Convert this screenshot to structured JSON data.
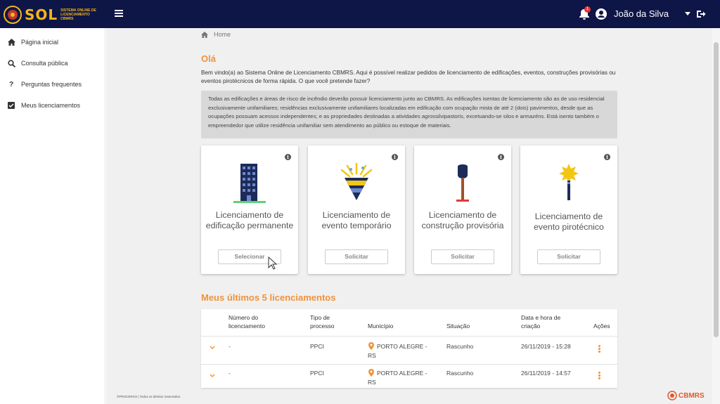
{
  "header": {
    "logo_text": "SOL",
    "logo_subtitle": "Sistema Online de Licenciamento CBMRS",
    "notification_count": "1",
    "user_name": "João da Silva",
    "brand_color": "#0e1647",
    "accent_color": "#f0923a"
  },
  "sidebar": {
    "items": [
      {
        "label": "Página inicial",
        "icon": "home-icon"
      },
      {
        "label": "Consulta pública",
        "icon": "search-icon"
      },
      {
        "label": "Perguntas frequentes",
        "icon": "question-icon"
      },
      {
        "label": "Meus licenciamentos",
        "icon": "checkbox-icon"
      }
    ]
  },
  "breadcrumb": {
    "home": "Home"
  },
  "main": {
    "greeting": "Olá",
    "intro": "Bem vindo(a) ao Sistema Online de Licenciamento CBMRS. Aqui é possível realizar pedidos de licenciamento de edificações, eventos, construções provisórias ou eventos pirotécnicos de forma rápida. O que você pretende fazer?",
    "notice": "Todas as edificações e áreas de risco de incêndio deverão possuir licenciamento junto ao CBMRS. As edificações isentas de licenciamento são as de uso residencial exclusivamente unifamiliares; residências exclusivamente unifamiliares localizadas em edificação com ocupação mista de até 2 (dois) pavimentos, desde que as ocupações possuam acessos independentes; e as propriedades destinadas a atividades agrossilvipastoris, excetuando-se silos e armazéns. Está isento também o empreendedor que utilize residência unifamiliar sem atendimento ao público ou estoque de materiais."
  },
  "cards": [
    {
      "title": "Licenciamento de edificação permanente",
      "button": "Selecionar",
      "icon": "building-icon"
    },
    {
      "title": "Licenciamento de evento temporário",
      "button": "Solicitar",
      "icon": "event-icon"
    },
    {
      "title": "Licenciamento de construção provisória",
      "button": "Solicitar",
      "icon": "shovel-icon"
    },
    {
      "title": "Licenciamento de evento pirotécnico",
      "button": "Solicitar",
      "icon": "firework-icon"
    }
  ],
  "recent": {
    "title": "Meus últimos 5 licenciamentos",
    "headers": {
      "numero": "Número do licenciamento",
      "tipo": "Tipo de processo",
      "municipio": "Município",
      "situacao": "Situação",
      "data": "Data e hora de criação",
      "acoes": "Ações"
    },
    "rows": [
      {
        "numero": "-",
        "tipo": "PPCI",
        "municipio": "PORTO ALEGRE - RS",
        "situacao": "Rascunho",
        "data": "26/11/2019 - 15:28"
      },
      {
        "numero": "-",
        "tipo": "PPCI",
        "municipio": "PORTO ALEGRE - RS",
        "situacao": "Rascunho",
        "data": "26/11/2019 - 14:57"
      }
    ]
  },
  "footer": {
    "copyright": "©PROCERGS | Todos os direitos reservados.",
    "logo": "CBMRS"
  }
}
